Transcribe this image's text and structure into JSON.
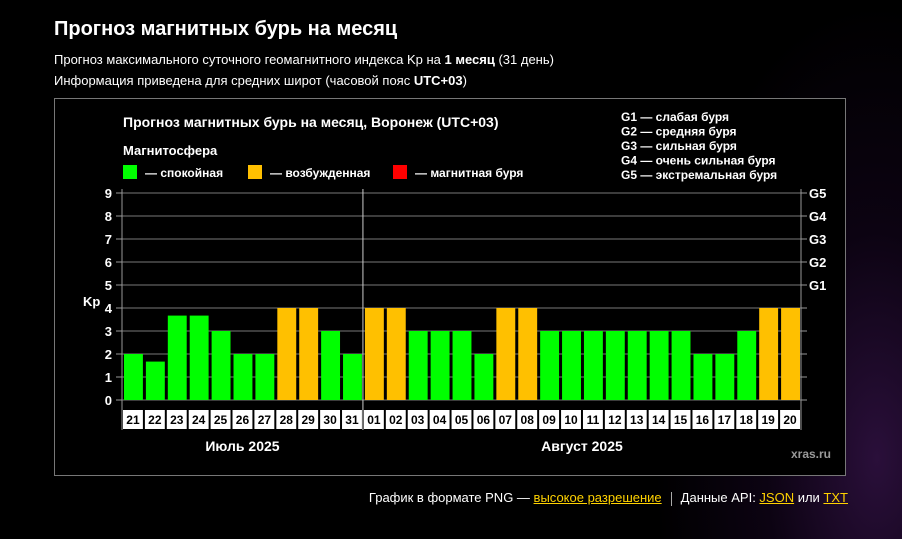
{
  "page": {
    "title": "Прогноз магнитных бурь на месяц",
    "subtitle1_pre": "Прогноз максимального суточного геомагнитного индекса Kp на ",
    "subtitle1_bold": "1 месяц",
    "subtitle1_post": " (31 день)",
    "subtitle2_pre": "Информация приведена для средних широт (часовой пояс ",
    "subtitle2_bold": "UTC+03",
    "subtitle2_post": ")"
  },
  "chart_data": {
    "type": "bar",
    "title": "Прогноз магнитных бурь на месяц, Воронеж (UTC+03)",
    "ylabel": "Kp",
    "ylim": [
      0,
      9
    ],
    "yticks": [
      "0",
      "1",
      "2",
      "3",
      "4",
      "5",
      "6",
      "7",
      "8",
      "9"
    ],
    "right_ticks": [
      {
        "kp": 5,
        "label": "G1"
      },
      {
        "kp": 6,
        "label": "G2"
      },
      {
        "kp": 7,
        "label": "G3"
      },
      {
        "kp": 8,
        "label": "G4"
      },
      {
        "kp": 9,
        "label": "G5"
      }
    ],
    "legend_title": "Магнитосфера",
    "legend": [
      {
        "label": "— спокойная",
        "color": "#00ff00"
      },
      {
        "label": "— возбужденная",
        "color": "#ffc000"
      },
      {
        "label": "— магнитная буря",
        "color": "#ff0000"
      }
    ],
    "storm_scale": [
      "G1 — слабая буря",
      "G2 — средняя буря",
      "G3 — сильная буря",
      "G4 — очень сильная буря",
      "G5 — экстремальная буря"
    ],
    "categories": [
      "21",
      "22",
      "23",
      "24",
      "25",
      "26",
      "27",
      "28",
      "29",
      "30",
      "31",
      "01",
      "02",
      "03",
      "04",
      "05",
      "06",
      "07",
      "08",
      "09",
      "10",
      "11",
      "12",
      "13",
      "14",
      "15",
      "16",
      "17",
      "18",
      "19",
      "20"
    ],
    "values": [
      2,
      1.67,
      3.67,
      3.67,
      3,
      2,
      2,
      4,
      4,
      3,
      2,
      4,
      4,
      3,
      3,
      3,
      2,
      4,
      4,
      3,
      3,
      3,
      3,
      3,
      3,
      3,
      2,
      2,
      3,
      4,
      4
    ],
    "colors": {
      "quiet": "#00ff00",
      "active": "#ffc000",
      "storm": "#ff0000"
    },
    "month_labels": [
      {
        "label": "Июль 2025",
        "start": 0,
        "end": 10
      },
      {
        "label": "Август 2025",
        "start": 11,
        "end": 30
      }
    ],
    "watermark": "xras.ru",
    "grid": true
  },
  "footer": {
    "text_pre": "График в формате PNG — ",
    "link_hires": "высокое разрешение",
    "api_label": "Данные API: ",
    "link_json": "JSON",
    "or": " или ",
    "link_txt": "TXT"
  }
}
